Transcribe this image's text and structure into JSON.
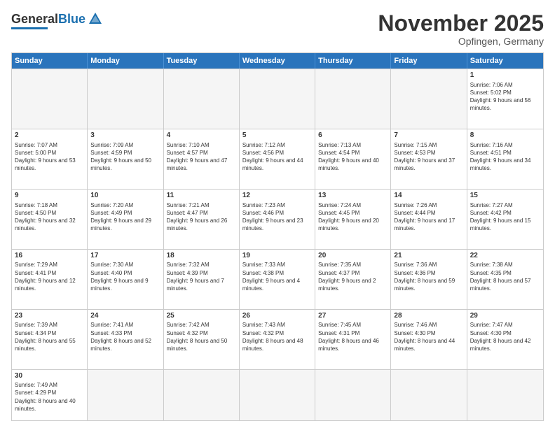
{
  "header": {
    "logo_general": "General",
    "logo_blue": "Blue",
    "month_title": "November 2025",
    "location": "Opfingen, Germany"
  },
  "days_of_week": [
    "Sunday",
    "Monday",
    "Tuesday",
    "Wednesday",
    "Thursday",
    "Friday",
    "Saturday"
  ],
  "weeks": [
    [
      {
        "day": "",
        "empty": true
      },
      {
        "day": "",
        "empty": true
      },
      {
        "day": "",
        "empty": true
      },
      {
        "day": "",
        "empty": true
      },
      {
        "day": "",
        "empty": true
      },
      {
        "day": "",
        "empty": true
      },
      {
        "day": "1",
        "sunrise": "7:06 AM",
        "sunset": "5:02 PM",
        "daylight": "9 hours and 56 minutes."
      }
    ],
    [
      {
        "day": "2",
        "sunrise": "7:07 AM",
        "sunset": "5:00 PM",
        "daylight": "9 hours and 53 minutes."
      },
      {
        "day": "3",
        "sunrise": "7:09 AM",
        "sunset": "4:59 PM",
        "daylight": "9 hours and 50 minutes."
      },
      {
        "day": "4",
        "sunrise": "7:10 AM",
        "sunset": "4:57 PM",
        "daylight": "9 hours and 47 minutes."
      },
      {
        "day": "5",
        "sunrise": "7:12 AM",
        "sunset": "4:56 PM",
        "daylight": "9 hours and 44 minutes."
      },
      {
        "day": "6",
        "sunrise": "7:13 AM",
        "sunset": "4:54 PM",
        "daylight": "9 hours and 40 minutes."
      },
      {
        "day": "7",
        "sunrise": "7:15 AM",
        "sunset": "4:53 PM",
        "daylight": "9 hours and 37 minutes."
      },
      {
        "day": "8",
        "sunrise": "7:16 AM",
        "sunset": "4:51 PM",
        "daylight": "9 hours and 34 minutes."
      }
    ],
    [
      {
        "day": "9",
        "sunrise": "7:18 AM",
        "sunset": "4:50 PM",
        "daylight": "9 hours and 32 minutes."
      },
      {
        "day": "10",
        "sunrise": "7:20 AM",
        "sunset": "4:49 PM",
        "daylight": "9 hours and 29 minutes."
      },
      {
        "day": "11",
        "sunrise": "7:21 AM",
        "sunset": "4:47 PM",
        "daylight": "9 hours and 26 minutes."
      },
      {
        "day": "12",
        "sunrise": "7:23 AM",
        "sunset": "4:46 PM",
        "daylight": "9 hours and 23 minutes."
      },
      {
        "day": "13",
        "sunrise": "7:24 AM",
        "sunset": "4:45 PM",
        "daylight": "9 hours and 20 minutes."
      },
      {
        "day": "14",
        "sunrise": "7:26 AM",
        "sunset": "4:44 PM",
        "daylight": "9 hours and 17 minutes."
      },
      {
        "day": "15",
        "sunrise": "7:27 AM",
        "sunset": "4:42 PM",
        "daylight": "9 hours and 15 minutes."
      }
    ],
    [
      {
        "day": "16",
        "sunrise": "7:29 AM",
        "sunset": "4:41 PM",
        "daylight": "9 hours and 12 minutes."
      },
      {
        "day": "17",
        "sunrise": "7:30 AM",
        "sunset": "4:40 PM",
        "daylight": "9 hours and 9 minutes."
      },
      {
        "day": "18",
        "sunrise": "7:32 AM",
        "sunset": "4:39 PM",
        "daylight": "9 hours and 7 minutes."
      },
      {
        "day": "19",
        "sunrise": "7:33 AM",
        "sunset": "4:38 PM",
        "daylight": "9 hours and 4 minutes."
      },
      {
        "day": "20",
        "sunrise": "7:35 AM",
        "sunset": "4:37 PM",
        "daylight": "9 hours and 2 minutes."
      },
      {
        "day": "21",
        "sunrise": "7:36 AM",
        "sunset": "4:36 PM",
        "daylight": "8 hours and 59 minutes."
      },
      {
        "day": "22",
        "sunrise": "7:38 AM",
        "sunset": "4:35 PM",
        "daylight": "8 hours and 57 minutes."
      }
    ],
    [
      {
        "day": "23",
        "sunrise": "7:39 AM",
        "sunset": "4:34 PM",
        "daylight": "8 hours and 55 minutes."
      },
      {
        "day": "24",
        "sunrise": "7:41 AM",
        "sunset": "4:33 PM",
        "daylight": "8 hours and 52 minutes."
      },
      {
        "day": "25",
        "sunrise": "7:42 AM",
        "sunset": "4:32 PM",
        "daylight": "8 hours and 50 minutes."
      },
      {
        "day": "26",
        "sunrise": "7:43 AM",
        "sunset": "4:32 PM",
        "daylight": "8 hours and 48 minutes."
      },
      {
        "day": "27",
        "sunrise": "7:45 AM",
        "sunset": "4:31 PM",
        "daylight": "8 hours and 46 minutes."
      },
      {
        "day": "28",
        "sunrise": "7:46 AM",
        "sunset": "4:30 PM",
        "daylight": "8 hours and 44 minutes."
      },
      {
        "day": "29",
        "sunrise": "7:47 AM",
        "sunset": "4:30 PM",
        "daylight": "8 hours and 42 minutes."
      }
    ],
    [
      {
        "day": "30",
        "sunrise": "7:49 AM",
        "sunset": "4:29 PM",
        "daylight": "8 hours and 40 minutes."
      },
      {
        "day": "",
        "empty": true
      },
      {
        "day": "",
        "empty": true
      },
      {
        "day": "",
        "empty": true
      },
      {
        "day": "",
        "empty": true
      },
      {
        "day": "",
        "empty": true
      },
      {
        "day": "",
        "empty": true
      }
    ]
  ]
}
